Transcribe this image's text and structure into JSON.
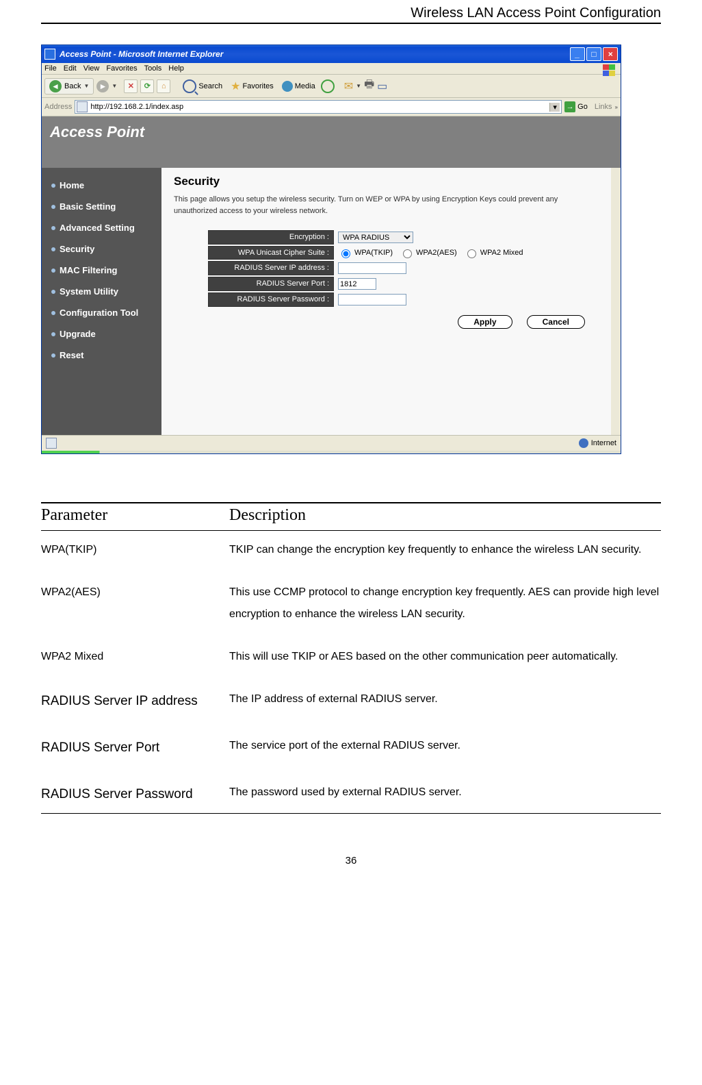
{
  "header": {
    "title": "Wireless LAN Access Point Configuration"
  },
  "browser": {
    "window_title": "Access Point - Microsoft Internet Explorer",
    "menus": {
      "file": "File",
      "edit": "Edit",
      "view": "View",
      "favorites": "Favorites",
      "tools": "Tools",
      "help": "Help"
    },
    "toolbar": {
      "back": "Back",
      "search": "Search",
      "favorites": "Favorites",
      "media": "Media"
    },
    "address": {
      "label": "Address",
      "url": "http://192.168.2.1/index.asp",
      "go": "Go",
      "links": "Links"
    },
    "banner": "Access Point",
    "nav": {
      "items": [
        "Home",
        "Basic Setting",
        "Advanced Setting",
        "Security",
        "MAC Filtering",
        "System Utility",
        "Configuration Tool",
        "Upgrade",
        "Reset"
      ]
    },
    "page": {
      "title": "Security",
      "desc": "This page allows you setup the wireless security. Turn on WEP or WPA by using Encryption Keys could prevent any unauthorized access to your wireless network.",
      "labels": {
        "encryption": "Encryption :",
        "cipher": "WPA Unicast Cipher Suite :",
        "radius_ip": "RADIUS Server IP address :",
        "radius_port": "RADIUS Server Port :",
        "radius_pw": "RADIUS Server Password :"
      },
      "values": {
        "encryption_selected": "WPA RADIUS",
        "radius_port": "1812",
        "radius_ip": "",
        "radius_pw": "",
        "cipher_options": {
          "tkip": "WPA(TKIP)",
          "aes": "WPA2(AES)",
          "mixed": "WPA2 Mixed"
        },
        "cipher_selected": "tkip"
      },
      "buttons": {
        "apply": "Apply",
        "cancel": "Cancel"
      }
    },
    "statusbar": {
      "zone": "Internet"
    }
  },
  "param_table": {
    "headers": {
      "param": "Parameter",
      "desc": "Description"
    },
    "rows": [
      {
        "name": "WPA(TKIP)",
        "big": false,
        "desc": "TKIP can change the encryption key frequently to enhance the wireless LAN security."
      },
      {
        "name": "WPA2(AES)",
        "big": false,
        "desc": "This use CCMP protocol to change encryption key frequently. AES can provide high level encryption to enhance the wireless LAN security."
      },
      {
        "name": "WPA2 Mixed",
        "big": false,
        "desc": "This will use TKIP or AES based on the other communication peer automatically."
      },
      {
        "name": "RADIUS Server IP address",
        "big": true,
        "desc": "The IP address of external RADIUS server."
      },
      {
        "name": "RADIUS Server Port",
        "big": true,
        "desc": "The service port of the external RADIUS server."
      },
      {
        "name": "RADIUS Server Password",
        "big": true,
        "desc": "The password used by external RADIUS server."
      }
    ]
  },
  "page_number": "36"
}
